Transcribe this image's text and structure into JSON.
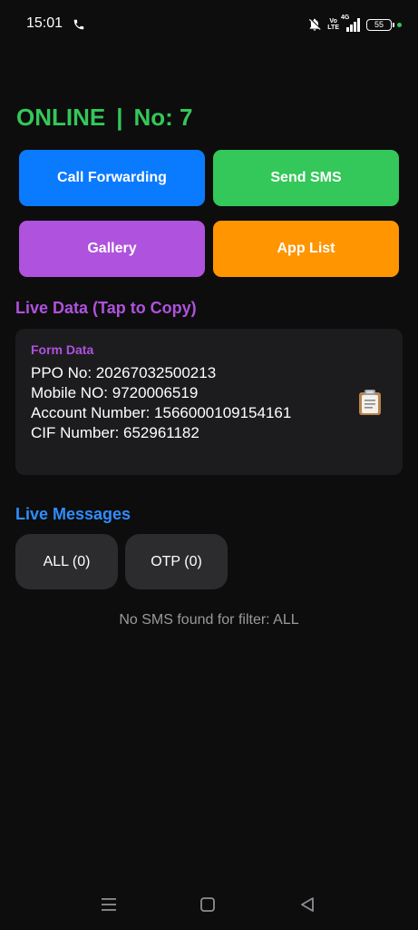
{
  "status_bar": {
    "time": "15:01",
    "volte_top": "Vo",
    "volte_bottom": "LTE",
    "network": "4G",
    "battery": "55"
  },
  "header": {
    "status": "ONLINE",
    "separator": "|",
    "device_number": "No: 7"
  },
  "actions": {
    "call_forwarding": "Call Forwarding",
    "send_sms": "Send SMS",
    "gallery": "Gallery",
    "app_list": "App List"
  },
  "live_data": {
    "title": "Live Data (Tap to Copy)",
    "card_label": "Form Data",
    "lines": [
      "PPO No: 20267032500213",
      "Mobile NO: 9720006519",
      "Account Number: 1566000109154161",
      "CIF Number: 652961182"
    ],
    "copy_icon": "clipboard-icon"
  },
  "live_messages": {
    "title": "Live Messages",
    "filters": [
      {
        "label": "ALL (0)"
      },
      {
        "label": "OTP (0)"
      }
    ],
    "empty_text": "No SMS found for filter: ALL"
  },
  "icons": {
    "phone": "phone-icon",
    "mute": "bell-off-icon",
    "signal": "signal-bars-icon",
    "battery": "battery-icon",
    "nav_menu": "menu-lines-icon",
    "nav_home": "square-home-icon",
    "nav_back": "triangle-back-icon"
  },
  "colors": {
    "online_green": "#34c759",
    "call_blue": "#0a7aff",
    "sms_green": "#34c759",
    "gallery_purple": "#af52de",
    "applist_orange": "#ff9500",
    "messages_blue": "#2f8dff",
    "card_bg": "#1c1c1e",
    "chip_bg": "#2c2c2e"
  }
}
